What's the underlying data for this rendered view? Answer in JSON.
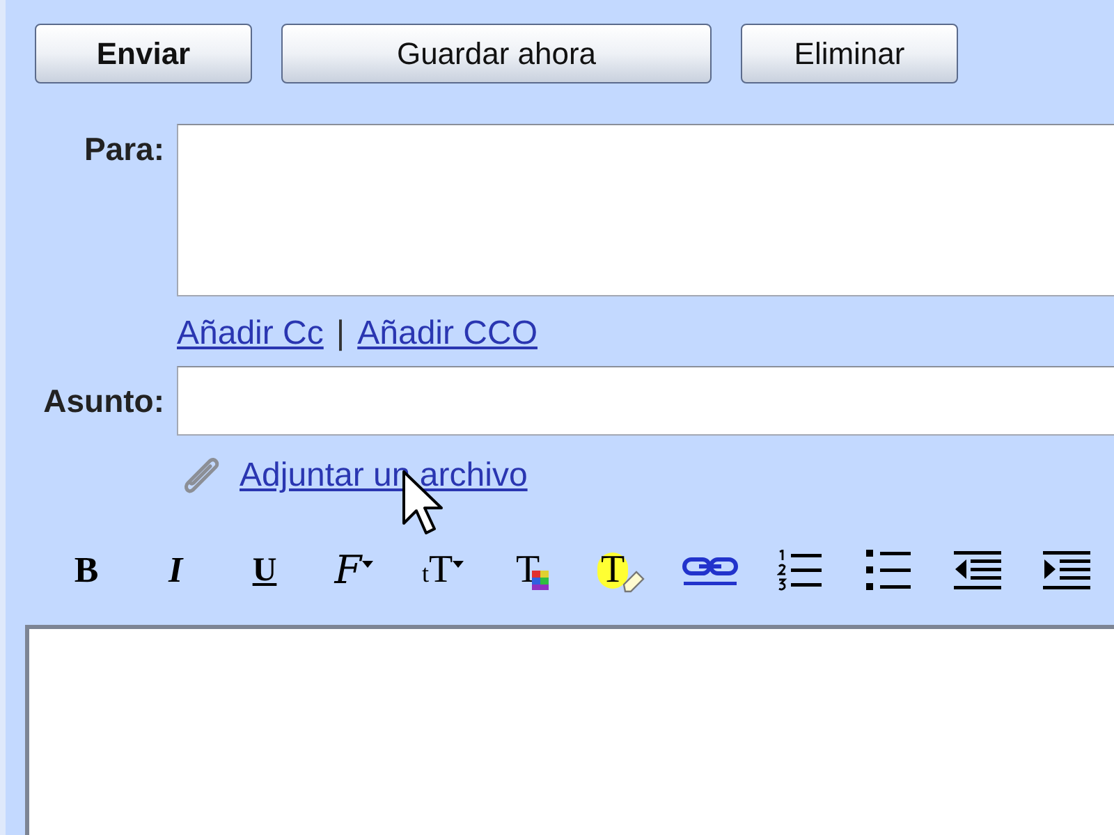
{
  "actions": [
    {
      "label": "Enviar",
      "primary": true
    },
    {
      "label": "Guardar ahora",
      "primary": false
    },
    {
      "label": "Eliminar",
      "primary": false
    }
  ],
  "to": {
    "label": "Para:"
  },
  "recipient_links": {
    "items": [
      {
        "label": "Añadir Cc"
      },
      {
        "label": "Añadir CCO"
      }
    ],
    "separator": "|"
  },
  "subject": {
    "label": "Asunto:"
  },
  "attach_link": {
    "label": "Adjuntar un archivo"
  },
  "toolbar": [
    {
      "kind": "bold",
      "glyph": "B"
    },
    {
      "kind": "italic",
      "glyph": "I"
    },
    {
      "kind": "underline",
      "glyph": "U"
    },
    {
      "kind": "font",
      "glyph": "F"
    },
    {
      "kind": "size",
      "glyph": "tT"
    },
    {
      "kind": "text_color",
      "glyph": "T"
    },
    {
      "kind": "highlight",
      "glyph": "T"
    },
    {
      "kind": "link"
    },
    {
      "kind": "numbered_list"
    },
    {
      "kind": "bulleted_list"
    },
    {
      "kind": "outdent"
    },
    {
      "kind": "indent"
    }
  ]
}
